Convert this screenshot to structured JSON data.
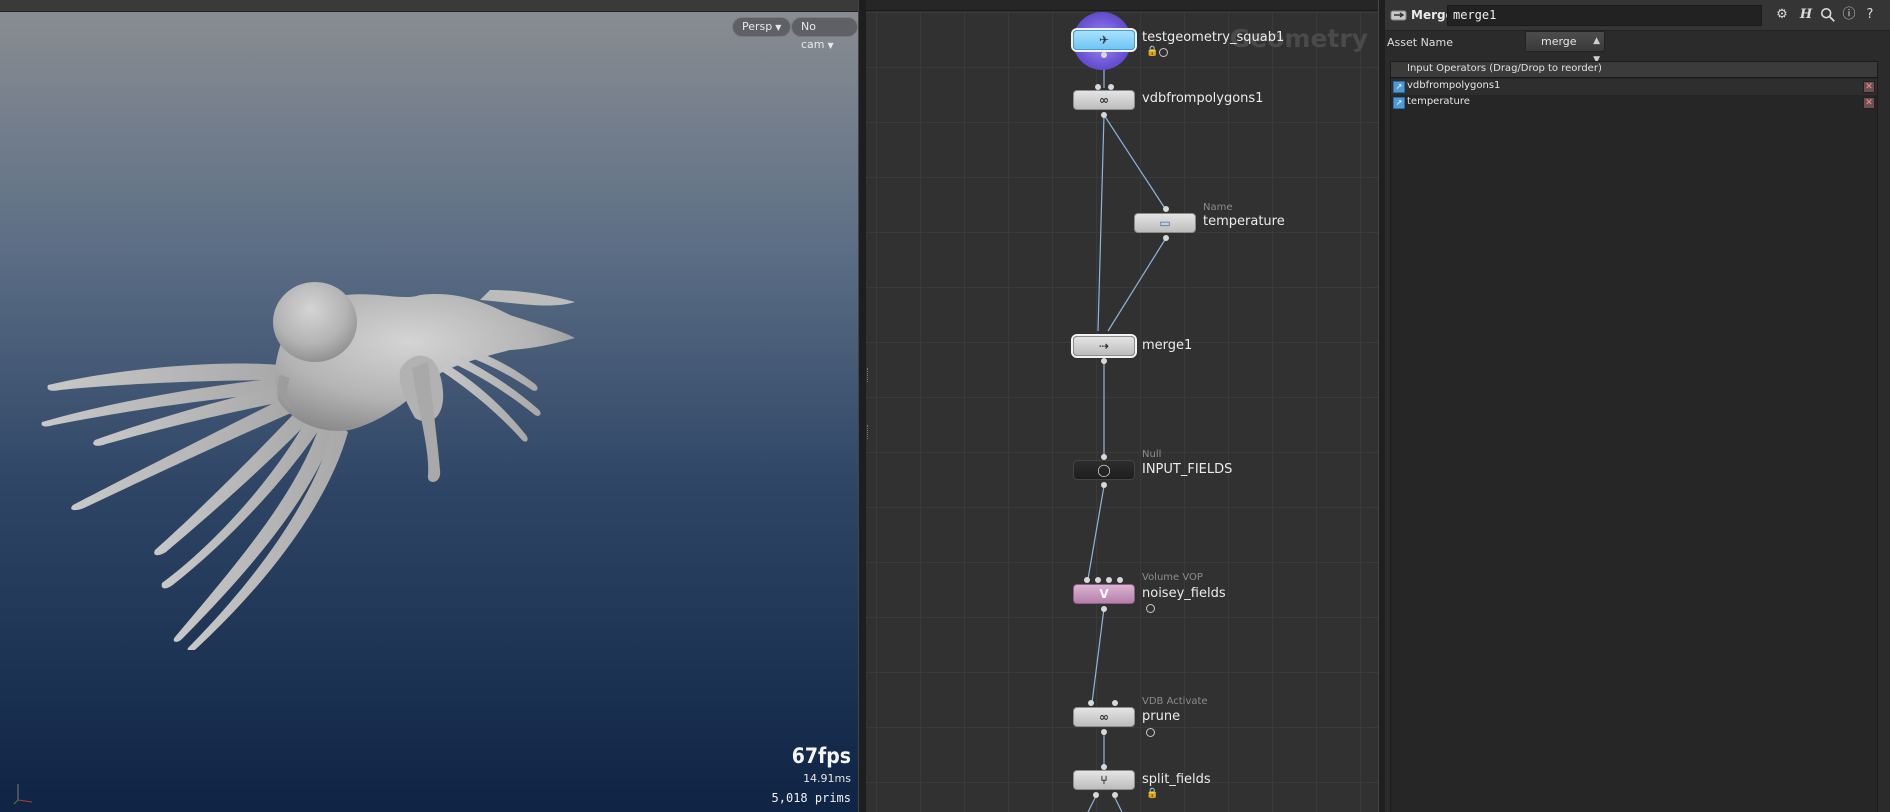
{
  "viewport": {
    "persp_label": "Persp",
    "cam_label": "No cam",
    "fps": "67fps",
    "ms": "14.91ms",
    "prims": "5,018  prims"
  },
  "network": {
    "context_label": "Geometry",
    "nodes": [
      {
        "name": "testgeometry_squab1",
        "type": ""
      },
      {
        "name": "vdbfrompolygons1",
        "type": ""
      },
      {
        "name": "temperature",
        "type": "Name"
      },
      {
        "name": "merge1",
        "type": ""
      },
      {
        "name": "INPUT_FIELDS",
        "type": "Null"
      },
      {
        "name": "noisey_fields",
        "type": "Volume VOP"
      },
      {
        "name": "prune",
        "type": "VDB Activate"
      },
      {
        "name": "split_fields",
        "type": ""
      }
    ]
  },
  "params": {
    "op_type": "Merge",
    "op_name": "merge1",
    "asset_label": "Asset Name",
    "asset_value": "merge",
    "list_header": "Input Operators (Drag/Drop to reorder)",
    "inputs": [
      {
        "name": "vdbfrompolygons1"
      },
      {
        "name": "temperature"
      }
    ],
    "icons": [
      "gear-icon",
      "help-h-icon",
      "search-icon",
      "info-icon",
      "question-icon"
    ]
  },
  "colors": {
    "viewport_top": "#8b8e92",
    "viewport_bottom": "#0f2444",
    "network_bg": "#313131",
    "wire": "#8fb4dd",
    "source_node": "#6fc6f3",
    "vop_node": "#b57fa9"
  }
}
